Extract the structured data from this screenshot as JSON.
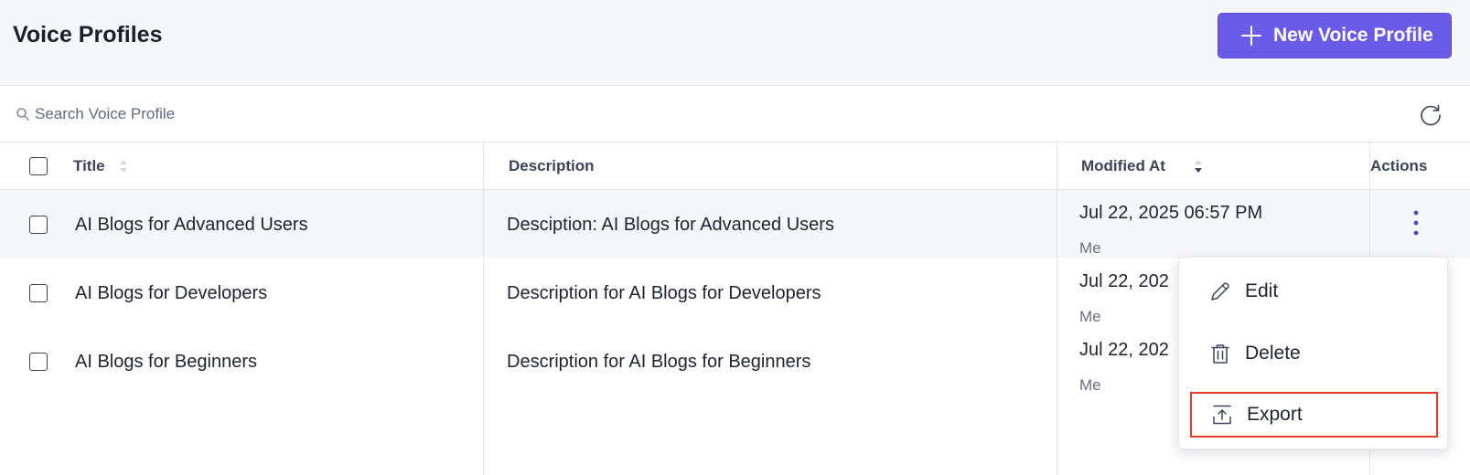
{
  "header": {
    "title": "Voice Profiles",
    "new_button_label": "New Voice Profile",
    "accent_color": "#6b5ce7"
  },
  "search": {
    "placeholder": "Search Voice Profile",
    "value": ""
  },
  "table": {
    "columns": {
      "title": "Title",
      "description": "Description",
      "modified_at": "Modified At",
      "actions": "Actions"
    },
    "rows": [
      {
        "title": "AI Blogs for Advanced Users",
        "description": "Desciption: AI Blogs for Advanced Users",
        "modified": "Jul 22, 2025 06:57 PM",
        "by": "Me"
      },
      {
        "title": "AI Blogs for Developers",
        "description": "Description for AI Blogs for Developers",
        "modified": "Jul 22, 202",
        "by": "Me"
      },
      {
        "title": "AI Blogs for Beginners",
        "description": "Description for AI Blogs for Beginners",
        "modified": "Jul 22, 202",
        "by": "Me"
      }
    ]
  },
  "menu": {
    "items": [
      {
        "label": "Edit",
        "icon": "pencil-icon"
      },
      {
        "label": "Delete",
        "icon": "trash-icon"
      },
      {
        "label": "Export",
        "icon": "export-icon"
      }
    ],
    "highlight_color": "#e23a2b"
  }
}
